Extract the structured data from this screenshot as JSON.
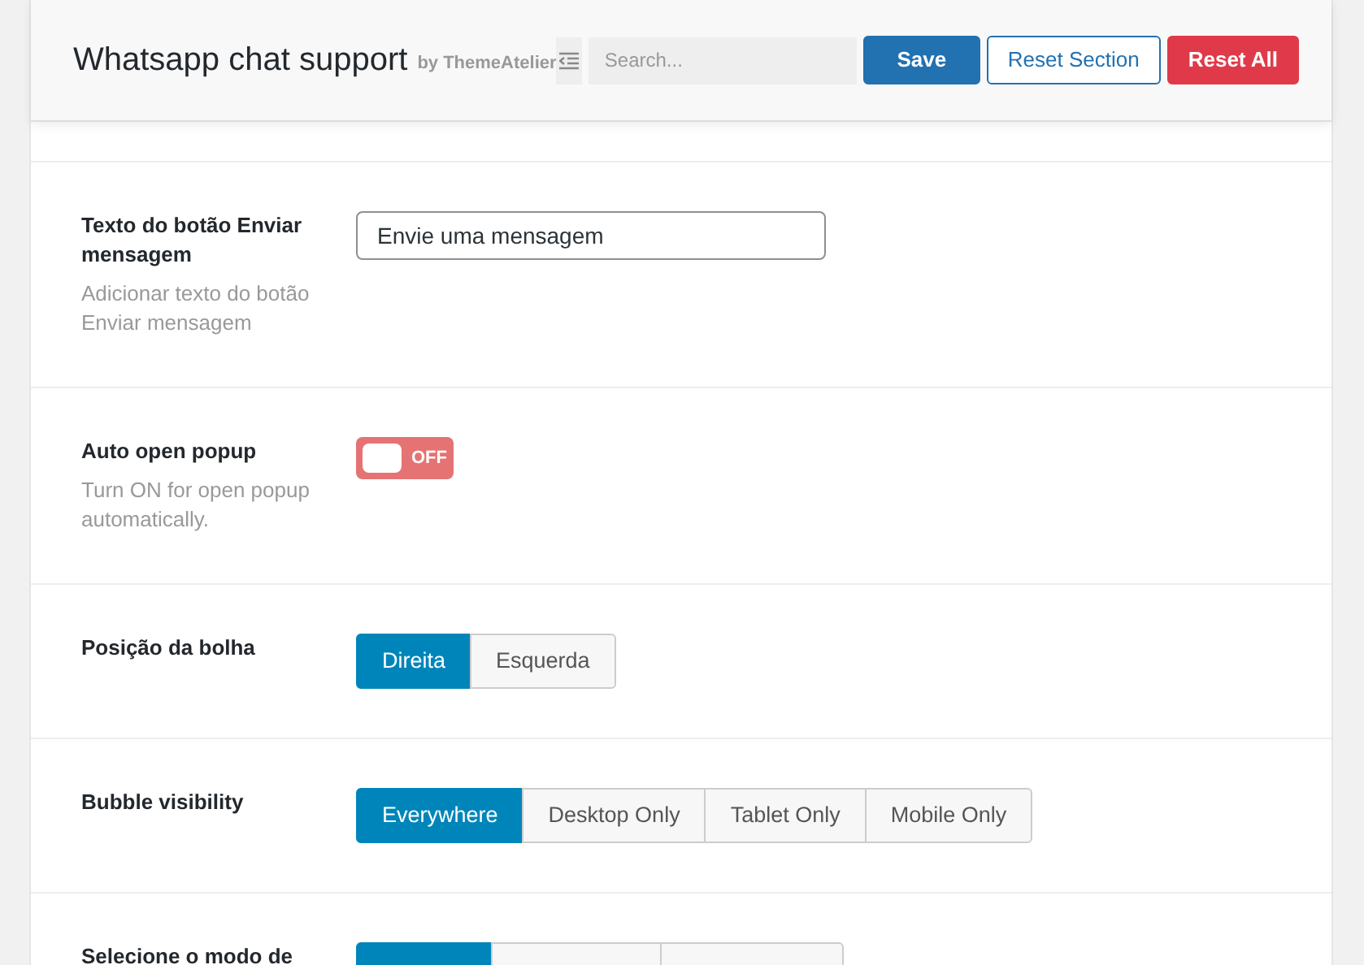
{
  "header": {
    "title": "Whatsapp chat support",
    "byline": "by ThemeAtelier",
    "search": {
      "placeholder": "Search..."
    },
    "buttons": [
      {
        "label": "Save",
        "kind": "primary"
      },
      {
        "label": "Reset Section",
        "kind": "outline"
      },
      {
        "label": "Reset All",
        "kind": "danger"
      }
    ]
  },
  "fields": [
    {
      "kind": "text",
      "label": "Texto do botão Enviar mensagem",
      "description": "Adicionar texto do botão Enviar mensagem",
      "value": "Envie uma mensagem"
    },
    {
      "kind": "switch",
      "label": "Auto open popup",
      "description": "Turn ON for open popup automatically.",
      "on": false,
      "switch_label": "OFF"
    },
    {
      "kind": "buttonset",
      "label": "Posição da bolha",
      "options": [
        {
          "label": "Direita",
          "selected": true
        },
        {
          "label": "Esquerda",
          "selected": false
        }
      ]
    },
    {
      "kind": "buttonset",
      "label": "Bubble visibility",
      "options": [
        {
          "label": "Everywhere",
          "selected": true
        },
        {
          "label": "Desktop Only",
          "selected": false
        },
        {
          "label": "Tablet Only",
          "selected": false
        },
        {
          "label": "Mobile Only",
          "selected": false
        }
      ]
    },
    {
      "kind": "buttonset",
      "label": "Selecione o modo de",
      "options": [
        {
          "selected": true
        },
        {
          "selected": false
        },
        {
          "selected": false
        }
      ]
    }
  ]
}
